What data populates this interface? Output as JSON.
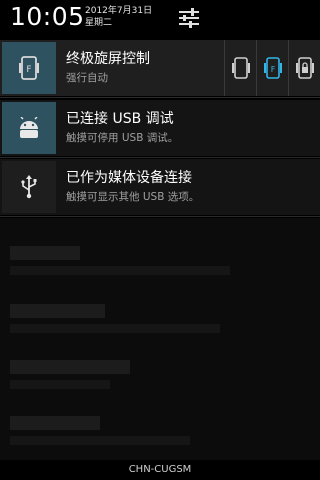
{
  "status_bar": {
    "time": "10:05",
    "date": "2012年7月31日",
    "weekday": "星期二",
    "settings_icon": "sliders-icon"
  },
  "notifications": [
    {
      "icon": "rotation-lock-icon",
      "title": "终极旋屏控制",
      "subtitle": "强行自动",
      "actions": [
        {
          "icon": "portrait-phone-icon"
        },
        {
          "icon": "force-auto-rotate-icon"
        },
        {
          "icon": "rotate-lock-icon"
        }
      ]
    },
    {
      "icon": "android-icon",
      "title": "已连接 USB 调试",
      "subtitle": "触摸可停用 USB 调试。"
    },
    {
      "icon": "usb-icon",
      "title": "已作为媒体设备连接",
      "subtitle": "触摸可显示其他 USB 选项。"
    }
  ],
  "carrier": "CHN-CUGSM",
  "colors": {
    "background": "#000000",
    "panel": "#141414",
    "accent_icon_bg": "#2f5260",
    "accent_blue": "#33b5e5"
  }
}
